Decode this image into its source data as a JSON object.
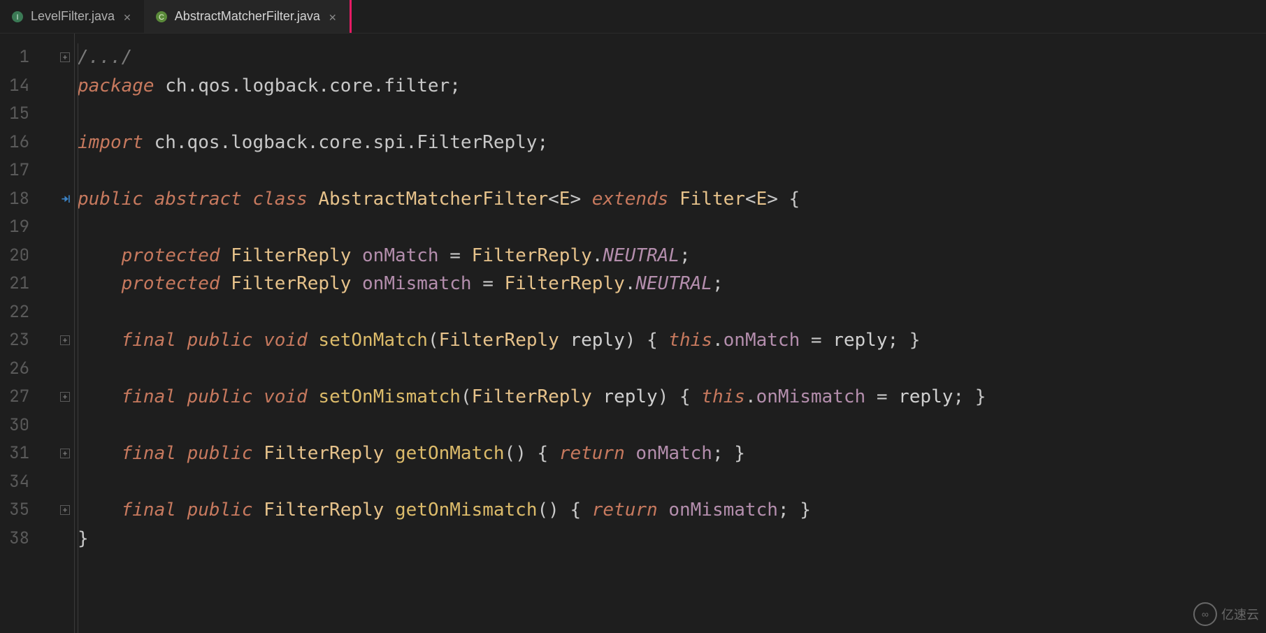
{
  "tabs": [
    {
      "label": "LevelFilter.java",
      "icon": "java-interface-icon",
      "active": false
    },
    {
      "label": "AbstractMatcherFilter.java",
      "icon": "java-class-icon",
      "active": true
    }
  ],
  "gutter_lines": [
    "1",
    "14",
    "15",
    "16",
    "17",
    "18",
    "19",
    "20",
    "21",
    "22",
    "23",
    "26",
    "27",
    "30",
    "31",
    "34",
    "35",
    "38"
  ],
  "fold_rows": [
    0,
    10,
    12,
    14,
    16
  ],
  "run_icon_row": 5,
  "code": {
    "l0": {
      "comment": "/.../"
    },
    "l1": {
      "kw": "package",
      "pkg": "ch.qos.logback.core.filter",
      "semi": ";"
    },
    "l2": {},
    "l3": {
      "kw": "import",
      "pkg": "ch.qos.logback.core.spi.FilterReply",
      "semi": ";"
    },
    "l4": {},
    "l5": {
      "kw1": "public",
      "kw2": "abstract",
      "kw3": "class",
      "cls": "AbstractMatcherFilter",
      "gen1": "<",
      "tp": "E",
      "gen2": ">",
      "kw4": "extends",
      "sup": "Filter",
      "gen3": "<",
      "tp2": "E",
      "gen4": ">",
      "br": "{"
    },
    "l6": {},
    "l7": {
      "kw": "protected",
      "type": "FilterReply",
      "field": "onMatch",
      "eq": "=",
      "rtype": "FilterReply",
      "dot": ".",
      "const": "NEUTRAL",
      "semi": ";"
    },
    "l8": {
      "kw": "protected",
      "type": "FilterReply",
      "field": "onMismatch",
      "eq": "=",
      "rtype": "FilterReply",
      "dot": ".",
      "const": "NEUTRAL",
      "semi": ";"
    },
    "l9": {},
    "l10": {
      "kw1": "final",
      "kw2": "public",
      "kw3": "void",
      "m": "setOnMatch",
      "po": "(",
      "pt": "FilterReply",
      "pn": "reply",
      "pc": ")",
      "bo": "{",
      "this": "this",
      "dot": ".",
      "fld": "onMatch",
      "eq": "=",
      "rv": "reply",
      "semi": ";",
      "bc": "}"
    },
    "l11": {},
    "l12": {
      "kw1": "final",
      "kw2": "public",
      "kw3": "void",
      "m": "setOnMismatch",
      "po": "(",
      "pt": "FilterReply",
      "pn": "reply",
      "pc": ")",
      "bo": "{",
      "this": "this",
      "dot": ".",
      "fld": "onMismatch",
      "eq": "=",
      "rv": "reply",
      "semi": ";",
      "bc": "}"
    },
    "l13": {},
    "l14": {
      "kw1": "final",
      "kw2": "public",
      "rt": "FilterReply",
      "m": "getOnMatch",
      "po": "(",
      "pc": ")",
      "bo": "{",
      "ret": "return",
      "fld": "onMatch",
      "semi": ";",
      "bc": "}"
    },
    "l15": {},
    "l16": {
      "kw1": "final",
      "kw2": "public",
      "rt": "FilterReply",
      "m": "getOnMismatch",
      "po": "(",
      "pc": ")",
      "bo": "{",
      "ret": "return",
      "fld": "onMismatch",
      "semi": ";",
      "bc": "}"
    },
    "l17": {
      "br": "}"
    }
  },
  "watermark": "亿速云"
}
